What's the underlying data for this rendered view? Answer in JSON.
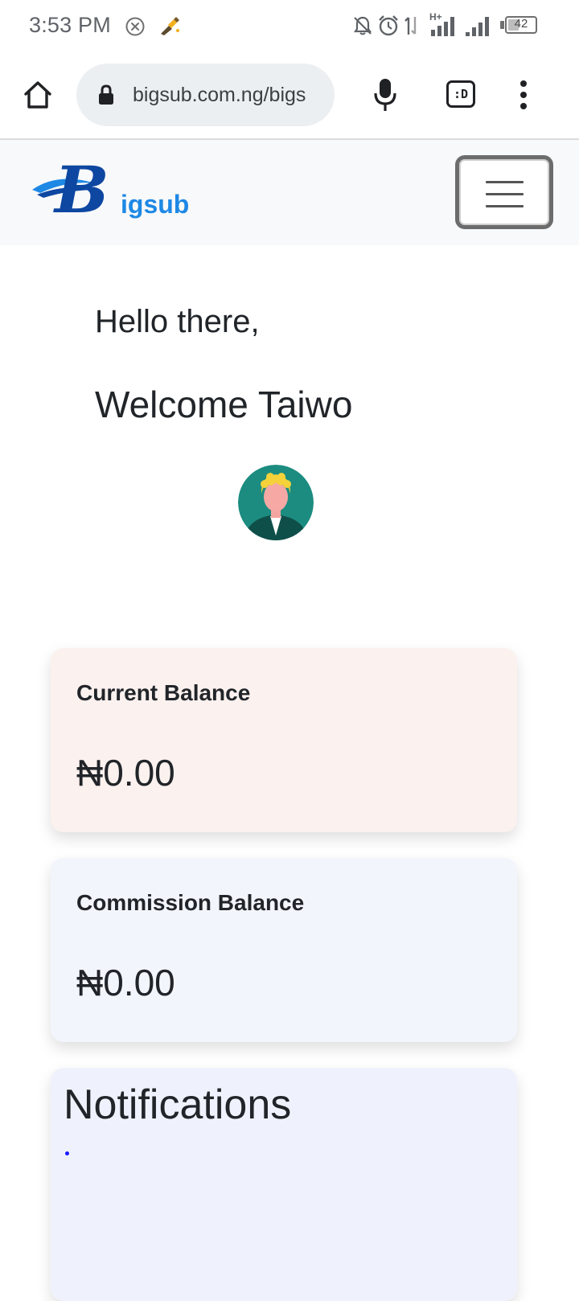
{
  "status_bar": {
    "time": "3:53 PM",
    "network_type": "H+",
    "battery_percent": "42",
    "battery_level": 0.42
  },
  "browser": {
    "url": "bigsub.com.ng/bigs"
  },
  "site": {
    "logo_letter": "B",
    "logo_text": "igsub",
    "logo_colors": {
      "primary": "#0d47a1",
      "accent": "#1e88e5"
    }
  },
  "greeting": {
    "hello": "Hello there,",
    "welcome": "Welcome Taiwo"
  },
  "cards": {
    "current_balance": {
      "label": "Current Balance",
      "amount": "₦0.00"
    },
    "commission_balance": {
      "label": "Commission Balance",
      "amount": "₦0.00"
    }
  },
  "notifications": {
    "title": "Notifications"
  },
  "icons": {
    "home": "home-icon",
    "lock": "lock-icon",
    "mic": "microphone-icon",
    "tabs": "tab-switcher-icon",
    "more": "more-vert-icon",
    "menu": "hamburger-menu-icon"
  }
}
